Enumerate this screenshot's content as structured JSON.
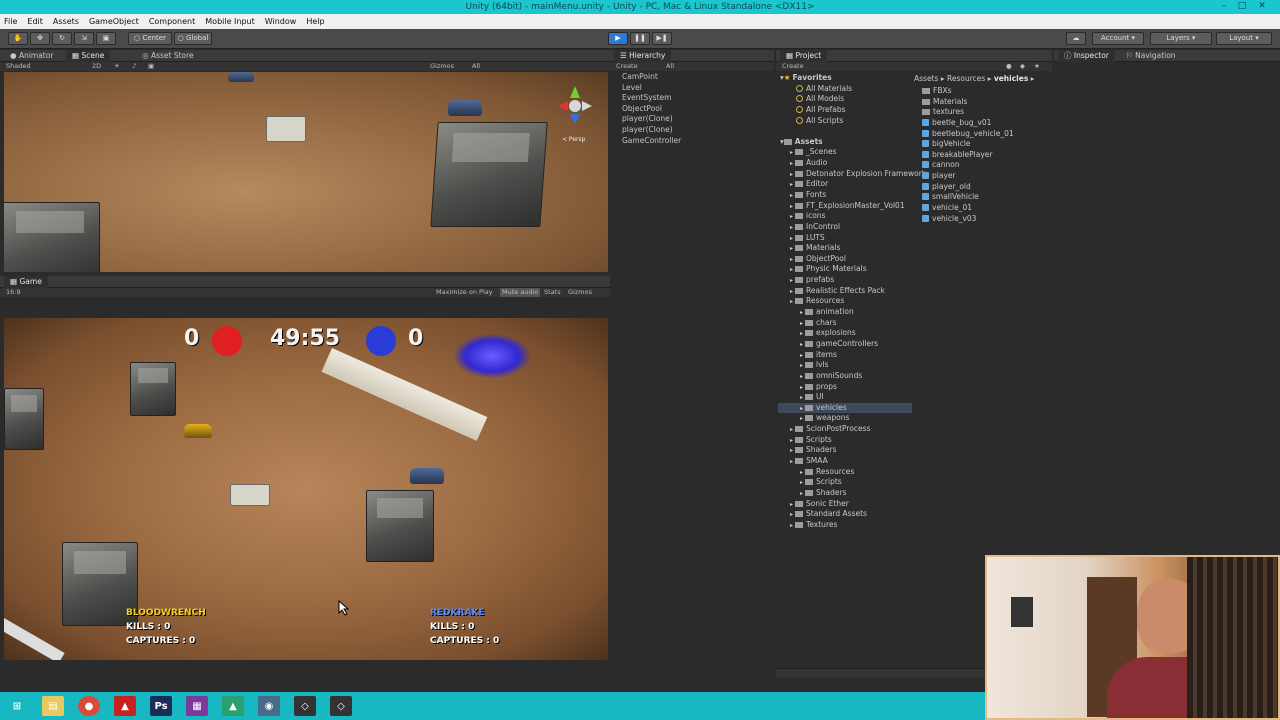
{
  "window": {
    "title": "Unity (64bit) - mainMenu.unity - Unity - PC, Mac & Linux Standalone <DX11>"
  },
  "menu": [
    "File",
    "Edit",
    "Assets",
    "GameObject",
    "Component",
    "Mobile Input",
    "Window",
    "Help"
  ],
  "toolbar": {
    "pivot": "Center",
    "space": "Global",
    "account": "Account",
    "layers": "Layers",
    "layout": "Layout"
  },
  "scene_panel": {
    "tabs": [
      "Animator",
      "Scene",
      "Asset Store"
    ],
    "shading": "Shaded",
    "mode_2d": "2D",
    "gizmos": "Gizmos",
    "search": "All",
    "persp": "< Persp"
  },
  "game_panel": {
    "tab": "Game",
    "aspect": "16:9",
    "options": [
      "Maximize on Play",
      "Mute audio",
      "Stats",
      "Gizmos"
    ]
  },
  "hud": {
    "red_score": "0",
    "timer": "49:55",
    "blue_score": "0",
    "red_team": {
      "name": "BLOODWRENCH",
      "kills_label": "KILLS :",
      "kills": "0",
      "captures_label": "CAPTURES :",
      "captures": "0"
    },
    "blue_team": {
      "name": "REDKRAKE",
      "kills_label": "KILLS :",
      "kills": "0",
      "captures_label": "CAPTURES :",
      "captures": "0"
    }
  },
  "hierarchy": {
    "tab": "Hierarchy",
    "create": "Create",
    "search": "All",
    "items": [
      "CamPoint",
      "Level",
      "EventSystem",
      "ObjectPool",
      "player(Clone)",
      "player(Clone)",
      "GameController"
    ]
  },
  "project": {
    "tab": "Project",
    "create": "Create",
    "favorites_label": "Favorites",
    "favorites": [
      "All Materials",
      "All Models",
      "All Prefabs",
      "All Scripts"
    ],
    "assets_label": "Assets",
    "folders": [
      {
        "name": "_Scenes",
        "indent": 1
      },
      {
        "name": "Audio",
        "indent": 1
      },
      {
        "name": "Detonator Explosion Framework",
        "indent": 1
      },
      {
        "name": "Editor",
        "indent": 1
      },
      {
        "name": "Fonts",
        "indent": 1
      },
      {
        "name": "FT_ExplosionMaster_Vol01",
        "indent": 1
      },
      {
        "name": "icons",
        "indent": 1
      },
      {
        "name": "InControl",
        "indent": 1
      },
      {
        "name": "LUTS",
        "indent": 1
      },
      {
        "name": "Materials",
        "indent": 1
      },
      {
        "name": "ObjectPool",
        "indent": 1
      },
      {
        "name": "Physic Materials",
        "indent": 1
      },
      {
        "name": "prefabs",
        "indent": 1
      },
      {
        "name": "Realistic Effects Pack",
        "indent": 1
      },
      {
        "name": "Resources",
        "indent": 1
      },
      {
        "name": "animation",
        "indent": 2
      },
      {
        "name": "chars",
        "indent": 2
      },
      {
        "name": "explosions",
        "indent": 2
      },
      {
        "name": "gameControllers",
        "indent": 2
      },
      {
        "name": "items",
        "indent": 2
      },
      {
        "name": "lvls",
        "indent": 2
      },
      {
        "name": "omniSounds",
        "indent": 2
      },
      {
        "name": "props",
        "indent": 2
      },
      {
        "name": "UI",
        "indent": 2
      },
      {
        "name": "vehicles",
        "indent": 2
      },
      {
        "name": "weapons",
        "indent": 2
      },
      {
        "name": "ScionPostProcess",
        "indent": 1
      },
      {
        "name": "Scripts",
        "indent": 1
      },
      {
        "name": "Shaders",
        "indent": 1
      },
      {
        "name": "SMAA",
        "indent": 1
      },
      {
        "name": "Resources",
        "indent": 2
      },
      {
        "name": "Scripts",
        "indent": 2
      },
      {
        "name": "Shaders",
        "indent": 2
      },
      {
        "name": "Sonic Ether",
        "indent": 1
      },
      {
        "name": "Standard Assets",
        "indent": 1
      },
      {
        "name": "Textures",
        "indent": 1
      }
    ],
    "selected_folder": "vehicles",
    "breadcrumb": [
      "Assets",
      "Resources",
      "vehicles"
    ],
    "contents": [
      {
        "name": "FBXs",
        "kind": "folder"
      },
      {
        "name": "Materials",
        "kind": "folder"
      },
      {
        "name": "textures",
        "kind": "folder"
      },
      {
        "name": "beetle_bug_v01",
        "kind": "prefab"
      },
      {
        "name": "beetlebug_vehicle_01",
        "kind": "prefab"
      },
      {
        "name": "bigVehicle",
        "kind": "prefab"
      },
      {
        "name": "breakablePlayer",
        "kind": "prefab"
      },
      {
        "name": "cannon",
        "kind": "prefab"
      },
      {
        "name": "player",
        "kind": "prefab"
      },
      {
        "name": "player_old",
        "kind": "prefab"
      },
      {
        "name": "smallVehicle",
        "kind": "prefab"
      },
      {
        "name": "vehicle_01",
        "kind": "prefab"
      },
      {
        "name": "vehicle_v03",
        "kind": "prefab"
      }
    ]
  },
  "inspector": {
    "tabs": [
      "Inspector",
      "Navigation"
    ]
  },
  "colors": {
    "play_blue": "#2d7ad6",
    "taskbar": "#17b8c2",
    "title_bar": "#1ac6cf",
    "red_team": "#e02020",
    "blue_team": "#2a3cd8"
  }
}
